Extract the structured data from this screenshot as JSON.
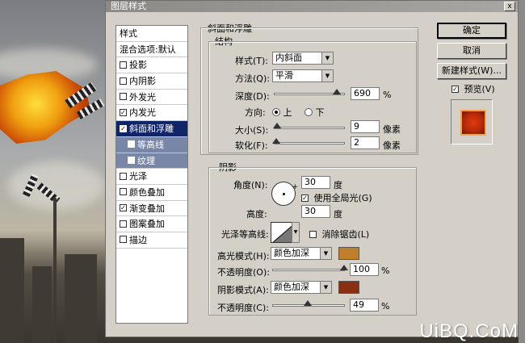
{
  "dialog": {
    "title": "图层样式",
    "close_glyph": "x"
  },
  "styles_panel": {
    "header": "样式",
    "items": [
      {
        "label": "混合选项:默认",
        "checked": null
      },
      {
        "label": "投影",
        "checked": false
      },
      {
        "label": "内阴影",
        "checked": false
      },
      {
        "label": "外发光",
        "checked": false
      },
      {
        "label": "内发光",
        "checked": true
      },
      {
        "label": "斜面和浮雕",
        "checked": true,
        "selected": true
      },
      {
        "label": "等高线",
        "checked": false,
        "sub": true
      },
      {
        "label": "纹理",
        "checked": false,
        "sub": true
      },
      {
        "label": "光泽",
        "checked": false
      },
      {
        "label": "颜色叠加",
        "checked": false
      },
      {
        "label": "渐变叠加",
        "checked": true
      },
      {
        "label": "图案叠加",
        "checked": false
      },
      {
        "label": "描边",
        "checked": false
      }
    ]
  },
  "bevel": {
    "section_title": "斜面和浮雕",
    "structure_title": "结构",
    "style_label": "样式(T):",
    "style_value": "内斜面",
    "technique_label": "方法(Q):",
    "technique_value": "平滑",
    "depth_label": "深度(D):",
    "depth_value": "690",
    "depth_slider": 0.9,
    "depth_unit": "%",
    "direction_label": "方向:",
    "direction_up": "上",
    "direction_down": "下",
    "direction_selected": "上",
    "size_label": "大小(S):",
    "size_value": "9",
    "size_slider": 0.04,
    "size_unit": "像素",
    "soften_label": "软化(F):",
    "soften_value": "2",
    "soften_slider": 0.02,
    "soften_unit": "像素"
  },
  "shading": {
    "section_title": "阴影",
    "angle_label": "角度(N):",
    "angle_value": "30",
    "angle_unit": "度",
    "global_light_label": "使用全局光(G)",
    "global_light_checked": true,
    "altitude_label": "高度:",
    "altitude_value": "30",
    "altitude_unit": "度",
    "gloss_contour_label": "光泽等高线:",
    "antialiased_label": "消除锯齿(L)",
    "antialiased_checked": false,
    "highlight_mode_label": "高光模式(H):",
    "highlight_mode_value": "颜色加深",
    "highlight_color": "#c0802a",
    "highlight_opacity_label": "不透明度(O):",
    "highlight_opacity_value": "100",
    "highlight_opacity_slider": 1.0,
    "highlight_opacity_unit": "%",
    "shadow_mode_label": "阴影模式(A):",
    "shadow_mode_value": "颜色加深",
    "shadow_color": "#8a3012",
    "shadow_opacity_label": "不透明度(C):",
    "shadow_opacity_value": "49",
    "shadow_opacity_slider": 0.49,
    "shadow_opacity_unit": "%"
  },
  "buttons": {
    "ok": "确定",
    "cancel": "取消",
    "new_style": "新建样式(W)...",
    "preview_label": "预览(V)",
    "preview_checked": true
  },
  "watermark": "UiBQ.CoM"
}
